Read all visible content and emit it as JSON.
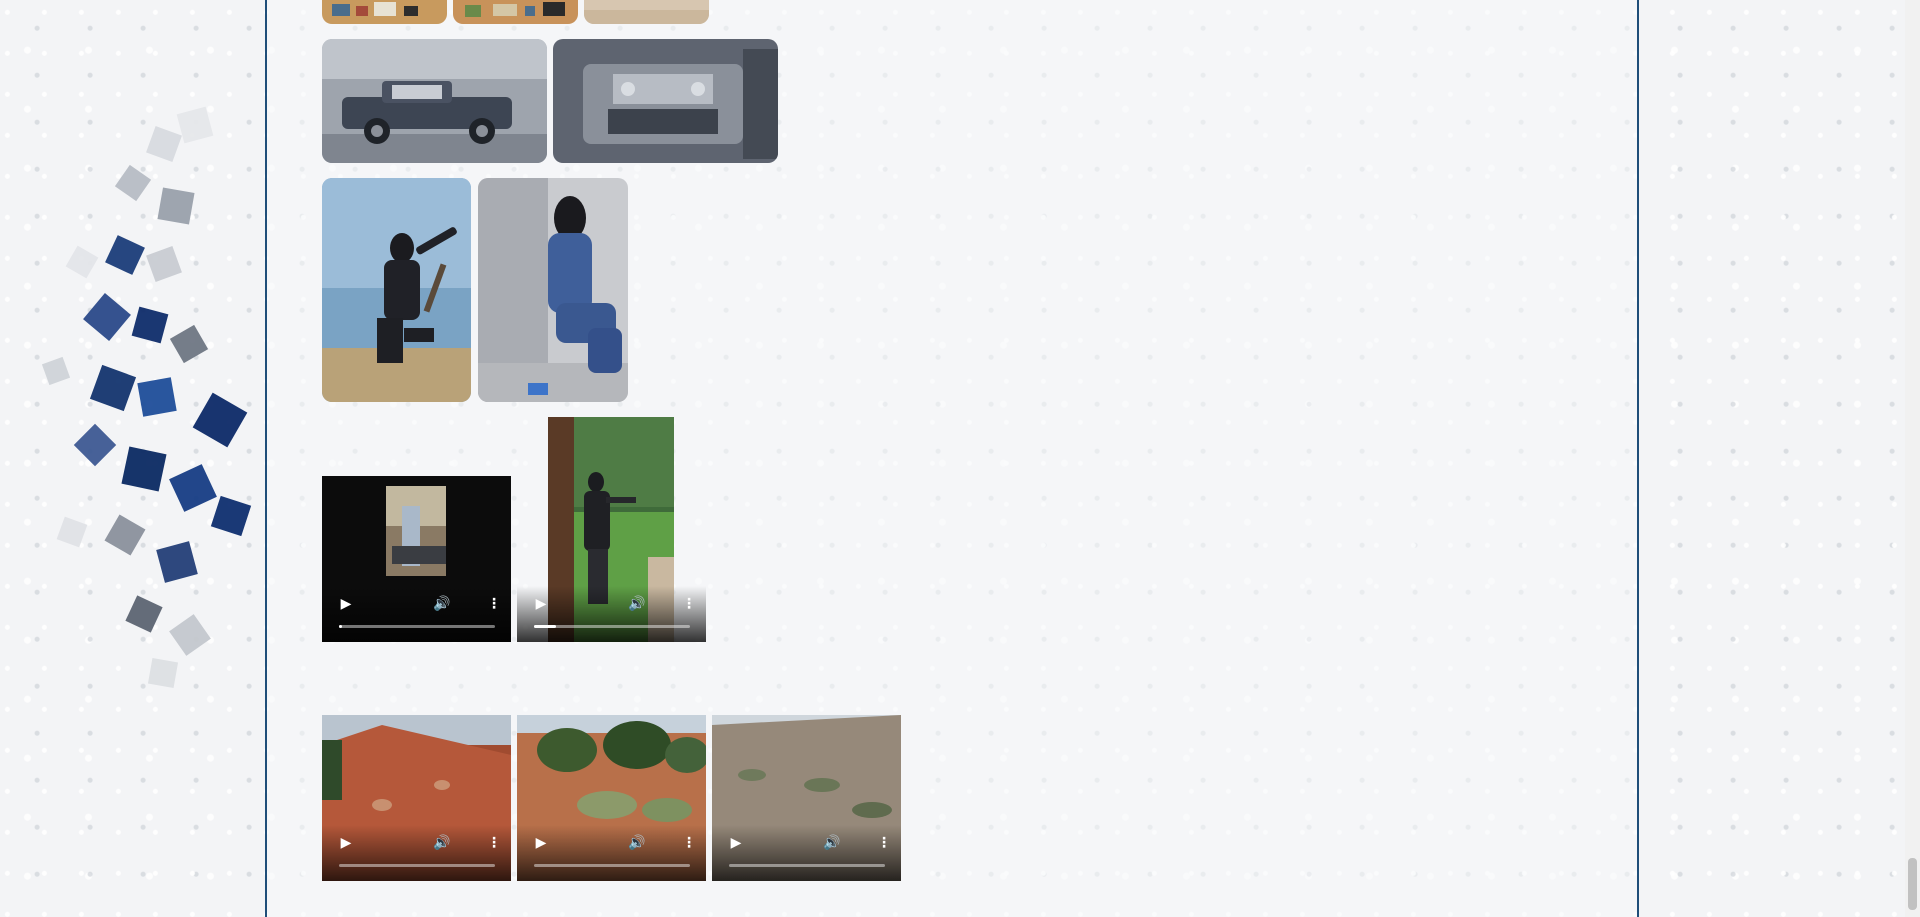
{
  "colors": {
    "frame_border": "#1f4e79",
    "background": "#f3f4f6",
    "player_controls": "#ffffff"
  },
  "icons": {
    "play": "play-icon",
    "volume": "volume-icon",
    "more": "more-vertical-icon"
  },
  "gallery": {
    "photos_top_row": [
      {
        "name": "photo-thumb-1",
        "scene": "collage"
      },
      {
        "name": "photo-thumb-2",
        "scene": "collage"
      },
      {
        "name": "photo-thumb-3",
        "scene": "sand"
      }
    ],
    "photos_row_2": [
      {
        "name": "photo-truck",
        "scene": "truck"
      },
      {
        "name": "photo-engine",
        "scene": "engine"
      }
    ],
    "photos_row_3": [
      {
        "name": "photo-person-kneeling",
        "scene": "kneeling"
      },
      {
        "name": "photo-person-sitting",
        "scene": "sitting"
      }
    ],
    "videos_row_1": [
      {
        "name": "video-indoor-range",
        "progress": 0.02
      },
      {
        "name": "video-outdoor-range",
        "progress": 0.14
      }
    ],
    "videos_row_2": [
      {
        "name": "video-red-cliff",
        "progress": 0.0
      },
      {
        "name": "video-trees",
        "progress": 0.0
      },
      {
        "name": "video-hillside",
        "progress": 0.0
      }
    ]
  },
  "controls": {
    "play_glyph": "▶",
    "mute_glyph": "🔊",
    "more_glyph": "⋮"
  }
}
